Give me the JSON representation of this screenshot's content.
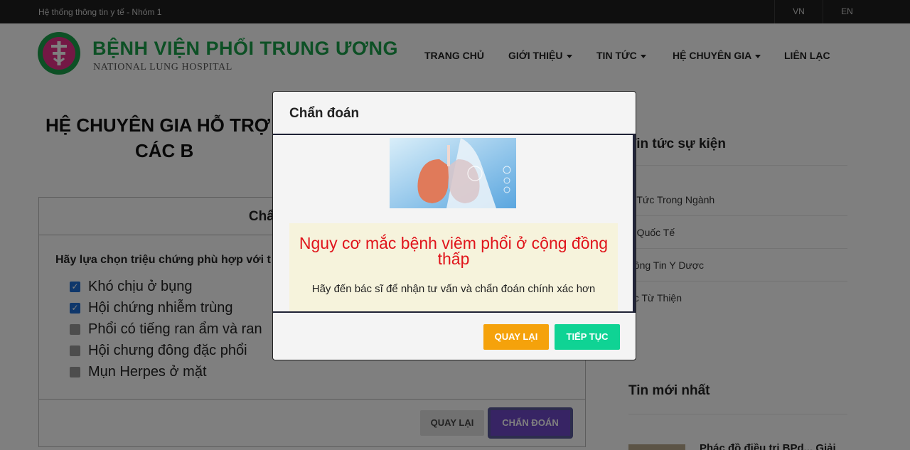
{
  "topbar": {
    "system_name": "Hệ thống thông tin y tế - Nhóm 1",
    "lang_vn": "VN",
    "lang_en": "EN"
  },
  "header": {
    "brand_vi": "BỆNH VIỆN PHỔI TRUNG ƯƠNG",
    "brand_en": "NATIONAL LUNG HOSPITAL",
    "nav": [
      {
        "label": "TRANG CHỦ",
        "dropdown": false
      },
      {
        "label": "GIỚI THIỆU",
        "dropdown": true
      },
      {
        "label": "TIN TỨC",
        "dropdown": true
      },
      {
        "label": "HỆ CHUYÊN GIA",
        "dropdown": true
      },
      {
        "label": "LIÊN LẠC",
        "dropdown": false
      }
    ]
  },
  "main": {
    "title_line1": "HỆ CHUYÊN GIA HỖ TRỢ",
    "title_line2": "CÁC B",
    "card_title": "Chẩn đoán",
    "prompt": "Hãy lựa chọn triệu chứng phù hợp với t",
    "symptoms": [
      {
        "label": "Khó chịu ở bụng",
        "checked": true
      },
      {
        "label": "Hội chứng nhiễm trùng",
        "checked": true
      },
      {
        "label": "Phổi có tiếng ran ẩm và ran",
        "checked": false
      },
      {
        "label": "Hội chưng đông đặc phổi",
        "checked": false
      },
      {
        "label": "Mụn Herpes ở mặt",
        "checked": false
      }
    ],
    "back_label": "QUAY LẠI",
    "diagnose_label": "CHẨN ĐOÁN"
  },
  "sidebar": {
    "events_title": "Tin tức sự kiện",
    "events": [
      "n Tức Trong Ngành",
      "n Quốc Tế",
      "hông Tin Y Dược",
      "óc Từ Thiện"
    ],
    "latest_title": "Tin mới nhất",
    "latest_item": "Phác đồ điều trị BPd... Giải"
  },
  "modal": {
    "title": "Chẩn đoán",
    "result_title": "Nguy cơ mắc bệnh viêm phổi ở cộng đồng thấp",
    "result_sub": "Hãy đến bác sĩ để nhận tư vấn và chẩn đoán chính xác hơn",
    "back_label": "QUAY LẠI",
    "next_label": "TIẾP TỤC"
  },
  "colors": {
    "brand_green": "#1aa14a",
    "result_red": "#e0141b",
    "back_orange": "#f5a20b",
    "next_green": "#0fd394",
    "diagnose_purple": "#6f49c8"
  }
}
